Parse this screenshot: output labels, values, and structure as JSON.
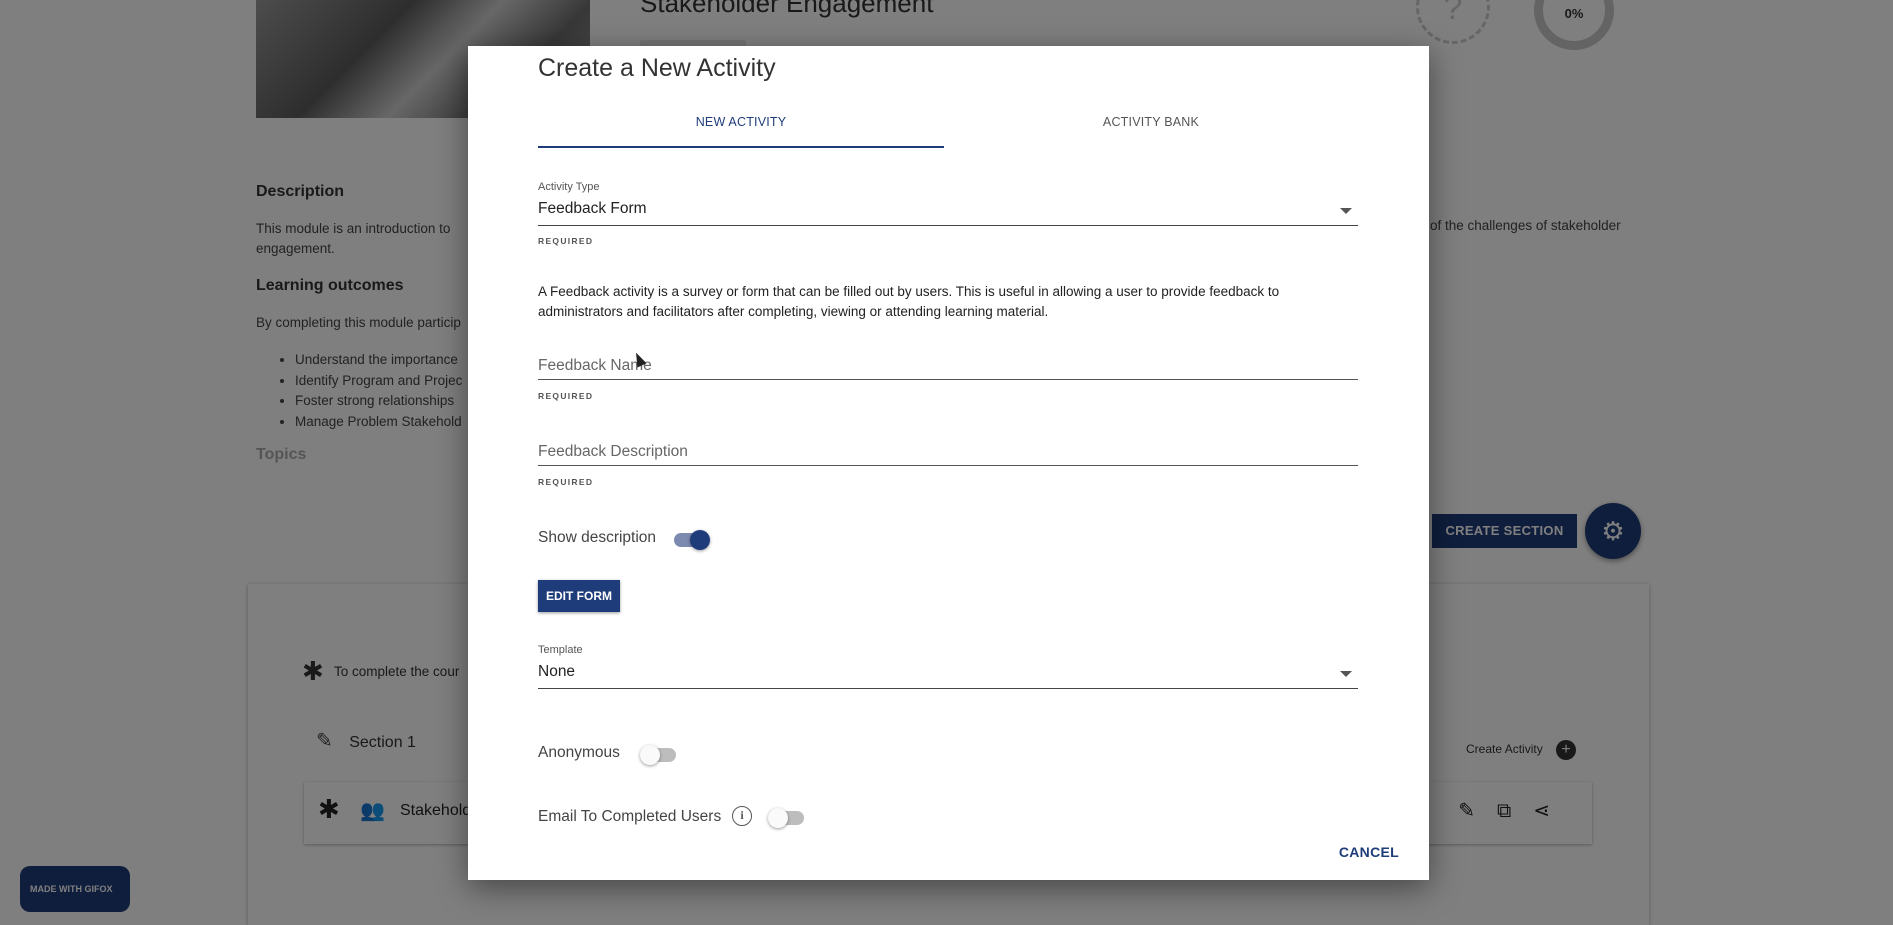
{
  "background": {
    "hero_title": "Stakeholder Engagement",
    "progress": "0%",
    "help_symbol": "?",
    "description_heading": "Description",
    "description_text_left": "This module is an introduction to",
    "description_text_right": "of the challenges of stakeholder",
    "description_text_line2": "engagement.",
    "learning_heading": "Learning outcomes",
    "learning_intro": "By completing this module particip",
    "learning_items": [
      "Understand the importance",
      "Identify Program and Projec",
      "Foster strong relationships",
      "Manage Problem Stakehold"
    ],
    "topics_heading": "Topics",
    "create_section_label": "CREATE SECTION",
    "required_note": "To complete the cour",
    "section_name": "Section 1",
    "create_activity_label": "Create Activity",
    "activity_name": "Stakehold",
    "gifox_label": "MADE WITH GIFOX"
  },
  "modal": {
    "title": "Create a New Activity",
    "tabs": [
      {
        "label": "NEW ACTIVITY",
        "active": true
      },
      {
        "label": "ACTIVITY BANK",
        "active": false
      }
    ],
    "activity_type": {
      "label": "Activity Type",
      "value": "Feedback Form",
      "required": "REQUIRED"
    },
    "info_text": "A Feedback activity is a survey or form that can be filled out by users. This is useful in allowing a user to provide feedback to administrators and facilitators after completing, viewing or attending learning material.",
    "feedback_name": {
      "placeholder": "Feedback Name",
      "value": "",
      "required": "REQUIRED"
    },
    "feedback_description": {
      "placeholder": "Feedback Description",
      "value": "",
      "required": "REQUIRED"
    },
    "show_description": {
      "label": "Show description",
      "on": true
    },
    "edit_form_label": "EDIT FORM",
    "template": {
      "label": "Template",
      "value": "None"
    },
    "anonymous": {
      "label": "Anonymous",
      "on": false
    },
    "email_completed": {
      "label": "Email To Completed Users",
      "on": false,
      "info_symbol": "i"
    },
    "cancel_label": "CANCEL"
  },
  "colors": {
    "primary": "#1f3c7a",
    "overlay": "rgba(0,0,0,0.5)"
  }
}
